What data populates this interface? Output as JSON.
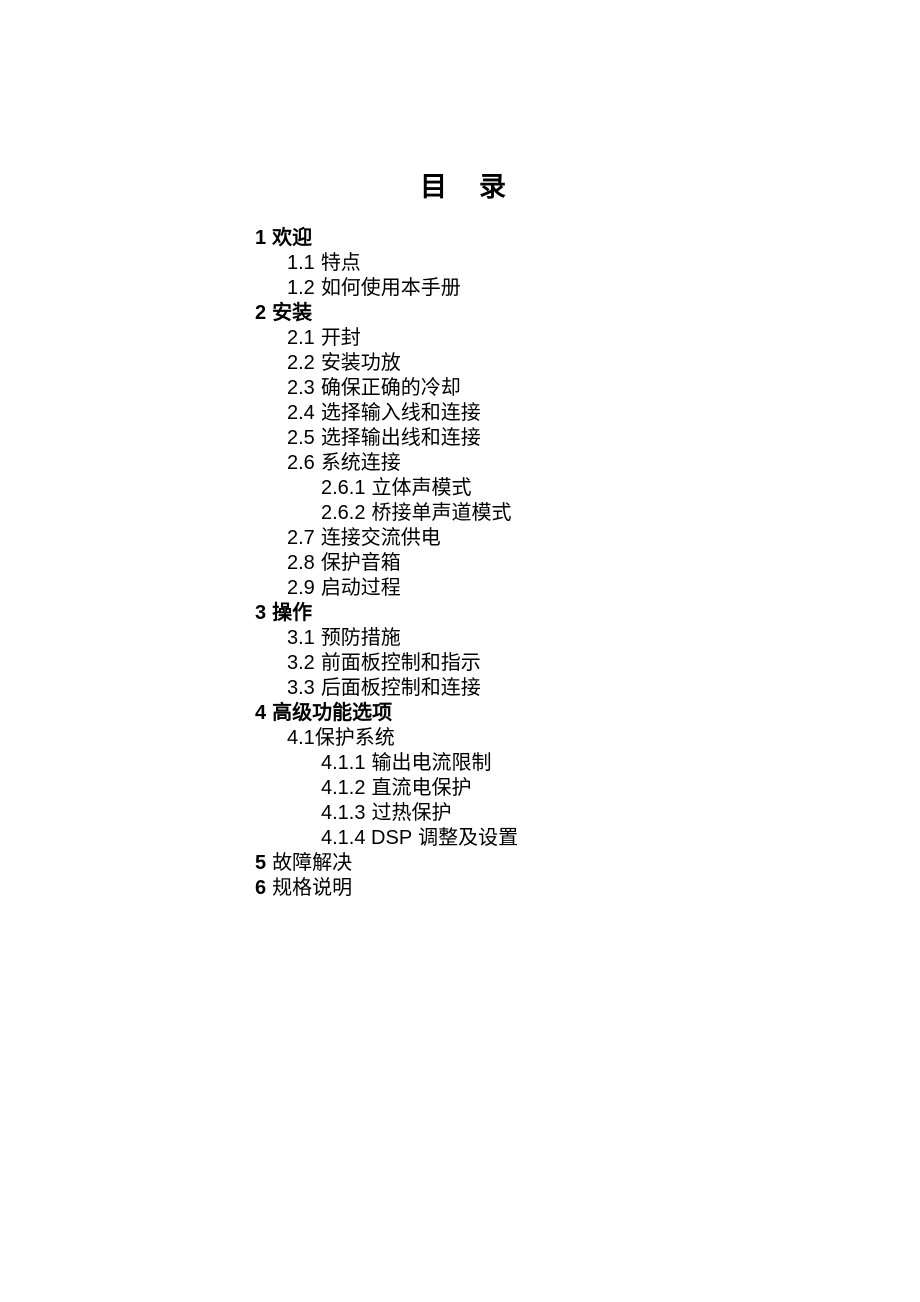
{
  "title": "目录",
  "toc": [
    {
      "level": 1,
      "num": "1",
      "text": "欢迎",
      "bold": true
    },
    {
      "level": 2,
      "num": "1.1",
      "text": "特点"
    },
    {
      "level": 2,
      "num": "1.2",
      "text": "如何使用本手册"
    },
    {
      "level": 1,
      "num": "2",
      "text": "安装",
      "bold": true
    },
    {
      "level": 2,
      "num": "2.1",
      "text": "开封"
    },
    {
      "level": 2,
      "num": "2.2",
      "text": "安装功放"
    },
    {
      "level": 2,
      "num": "2.3",
      "text": "确保正确的冷却"
    },
    {
      "level": 2,
      "num": "2.4",
      "text": "选择输入线和连接"
    },
    {
      "level": 2,
      "num": "2.5",
      "text": "选择输出线和连接"
    },
    {
      "level": 2,
      "num": "2.6",
      "text": "系统连接"
    },
    {
      "level": 3,
      "num": "2.6.1",
      "text": "立体声模式"
    },
    {
      "level": 3,
      "num": "2.6.2",
      "text": "桥接单声道模式"
    },
    {
      "level": 2,
      "num": "2.7",
      "text": "连接交流供电"
    },
    {
      "level": 2,
      "num": "2.8",
      "text": "保护音箱"
    },
    {
      "level": 2,
      "num": "2.9",
      "text": "启动过程"
    },
    {
      "level": 1,
      "num": "3",
      "text": "操作",
      "bold": true
    },
    {
      "level": 2,
      "num": "3.1",
      "text": "预防措施"
    },
    {
      "level": 2,
      "num": "3.2",
      "text": "前面板控制和指示"
    },
    {
      "level": 2,
      "num": "3.3",
      "text": "后面板控制和连接"
    },
    {
      "level": 1,
      "num": "4",
      "text": "高级功能选项",
      "bold": true
    },
    {
      "level": 2,
      "num": "4.1",
      "text": "保护系统",
      "tight": true
    },
    {
      "level": 3,
      "num": "4.1.1",
      "text": "输出电流限制"
    },
    {
      "level": 3,
      "num": "4.1.2",
      "text": "直流电保护"
    },
    {
      "level": 3,
      "num": "4.1.3",
      "text": "过热保护"
    },
    {
      "level": 3,
      "num": "4.1.4 DSP",
      "text": "调整及设置"
    },
    {
      "level": 1,
      "num": "5",
      "text": "故障解决",
      "bold": false
    },
    {
      "level": 1,
      "num": "6",
      "text": "规格说明",
      "bold": false
    }
  ]
}
